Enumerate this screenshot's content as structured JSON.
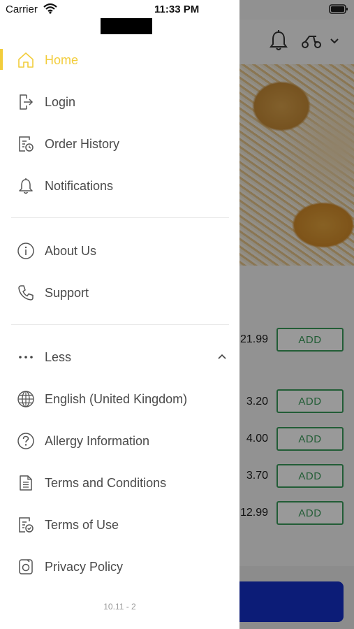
{
  "status_bar": {
    "carrier": "Carrier",
    "time": "11:33 PM"
  },
  "menu": {
    "primary": [
      {
        "label": "Home",
        "icon": "home-icon",
        "active": true
      },
      {
        "label": "Login",
        "icon": "login-icon"
      },
      {
        "label": "Order History",
        "icon": "order-history-icon"
      },
      {
        "label": "Notifications",
        "icon": "bell-icon"
      }
    ],
    "secondary": [
      {
        "label": "About Us",
        "icon": "info-icon"
      },
      {
        "label": "Support",
        "icon": "phone-icon"
      }
    ],
    "more": [
      {
        "label": "Less",
        "icon": "more-dots-icon"
      },
      {
        "label": "English (United Kingdom)",
        "icon": "globe-icon"
      },
      {
        "label": "Allergy Information",
        "icon": "question-icon"
      },
      {
        "label": "Terms and Conditions",
        "icon": "document-icon"
      },
      {
        "label": "Terms of Use",
        "icon": "terms-check-icon"
      },
      {
        "label": "Privacy Policy",
        "icon": "privacy-icon"
      }
    ]
  },
  "version": "10.11 - 2",
  "background": {
    "prices": [
      "21.99",
      "3.20",
      "4.00",
      "3.70",
      "12.99"
    ],
    "add_label": "ADD"
  },
  "colors": {
    "accent": "#f2cd3c",
    "add_green": "#3a9b5a",
    "checkout_blue": "#1530c7"
  }
}
